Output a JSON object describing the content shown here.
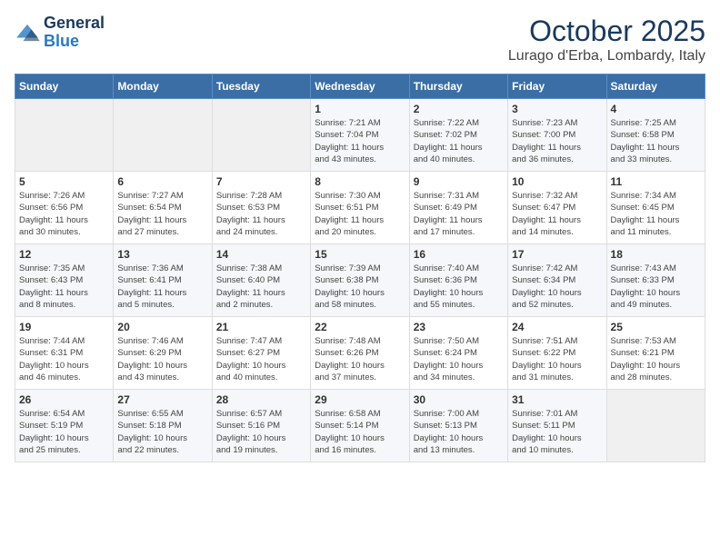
{
  "logo": {
    "line1": "General",
    "line2": "Blue"
  },
  "title": "October 2025",
  "location": "Lurago d'Erba, Lombardy, Italy",
  "days_header": [
    "Sunday",
    "Monday",
    "Tuesday",
    "Wednesday",
    "Thursday",
    "Friday",
    "Saturday"
  ],
  "weeks": [
    [
      {
        "day": "",
        "info": ""
      },
      {
        "day": "",
        "info": ""
      },
      {
        "day": "",
        "info": ""
      },
      {
        "day": "1",
        "info": "Sunrise: 7:21 AM\nSunset: 7:04 PM\nDaylight: 11 hours\nand 43 minutes."
      },
      {
        "day": "2",
        "info": "Sunrise: 7:22 AM\nSunset: 7:02 PM\nDaylight: 11 hours\nand 40 minutes."
      },
      {
        "day": "3",
        "info": "Sunrise: 7:23 AM\nSunset: 7:00 PM\nDaylight: 11 hours\nand 36 minutes."
      },
      {
        "day": "4",
        "info": "Sunrise: 7:25 AM\nSunset: 6:58 PM\nDaylight: 11 hours\nand 33 minutes."
      }
    ],
    [
      {
        "day": "5",
        "info": "Sunrise: 7:26 AM\nSunset: 6:56 PM\nDaylight: 11 hours\nand 30 minutes."
      },
      {
        "day": "6",
        "info": "Sunrise: 7:27 AM\nSunset: 6:54 PM\nDaylight: 11 hours\nand 27 minutes."
      },
      {
        "day": "7",
        "info": "Sunrise: 7:28 AM\nSunset: 6:53 PM\nDaylight: 11 hours\nand 24 minutes."
      },
      {
        "day": "8",
        "info": "Sunrise: 7:30 AM\nSunset: 6:51 PM\nDaylight: 11 hours\nand 20 minutes."
      },
      {
        "day": "9",
        "info": "Sunrise: 7:31 AM\nSunset: 6:49 PM\nDaylight: 11 hours\nand 17 minutes."
      },
      {
        "day": "10",
        "info": "Sunrise: 7:32 AM\nSunset: 6:47 PM\nDaylight: 11 hours\nand 14 minutes."
      },
      {
        "day": "11",
        "info": "Sunrise: 7:34 AM\nSunset: 6:45 PM\nDaylight: 11 hours\nand 11 minutes."
      }
    ],
    [
      {
        "day": "12",
        "info": "Sunrise: 7:35 AM\nSunset: 6:43 PM\nDaylight: 11 hours\nand 8 minutes."
      },
      {
        "day": "13",
        "info": "Sunrise: 7:36 AM\nSunset: 6:41 PM\nDaylight: 11 hours\nand 5 minutes."
      },
      {
        "day": "14",
        "info": "Sunrise: 7:38 AM\nSunset: 6:40 PM\nDaylight: 11 hours\nand 2 minutes."
      },
      {
        "day": "15",
        "info": "Sunrise: 7:39 AM\nSunset: 6:38 PM\nDaylight: 10 hours\nand 58 minutes."
      },
      {
        "day": "16",
        "info": "Sunrise: 7:40 AM\nSunset: 6:36 PM\nDaylight: 10 hours\nand 55 minutes."
      },
      {
        "day": "17",
        "info": "Sunrise: 7:42 AM\nSunset: 6:34 PM\nDaylight: 10 hours\nand 52 minutes."
      },
      {
        "day": "18",
        "info": "Sunrise: 7:43 AM\nSunset: 6:33 PM\nDaylight: 10 hours\nand 49 minutes."
      }
    ],
    [
      {
        "day": "19",
        "info": "Sunrise: 7:44 AM\nSunset: 6:31 PM\nDaylight: 10 hours\nand 46 minutes."
      },
      {
        "day": "20",
        "info": "Sunrise: 7:46 AM\nSunset: 6:29 PM\nDaylight: 10 hours\nand 43 minutes."
      },
      {
        "day": "21",
        "info": "Sunrise: 7:47 AM\nSunset: 6:27 PM\nDaylight: 10 hours\nand 40 minutes."
      },
      {
        "day": "22",
        "info": "Sunrise: 7:48 AM\nSunset: 6:26 PM\nDaylight: 10 hours\nand 37 minutes."
      },
      {
        "day": "23",
        "info": "Sunrise: 7:50 AM\nSunset: 6:24 PM\nDaylight: 10 hours\nand 34 minutes."
      },
      {
        "day": "24",
        "info": "Sunrise: 7:51 AM\nSunset: 6:22 PM\nDaylight: 10 hours\nand 31 minutes."
      },
      {
        "day": "25",
        "info": "Sunrise: 7:53 AM\nSunset: 6:21 PM\nDaylight: 10 hours\nand 28 minutes."
      }
    ],
    [
      {
        "day": "26",
        "info": "Sunrise: 6:54 AM\nSunset: 5:19 PM\nDaylight: 10 hours\nand 25 minutes."
      },
      {
        "day": "27",
        "info": "Sunrise: 6:55 AM\nSunset: 5:18 PM\nDaylight: 10 hours\nand 22 minutes."
      },
      {
        "day": "28",
        "info": "Sunrise: 6:57 AM\nSunset: 5:16 PM\nDaylight: 10 hours\nand 19 minutes."
      },
      {
        "day": "29",
        "info": "Sunrise: 6:58 AM\nSunset: 5:14 PM\nDaylight: 10 hours\nand 16 minutes."
      },
      {
        "day": "30",
        "info": "Sunrise: 7:00 AM\nSunset: 5:13 PM\nDaylight: 10 hours\nand 13 minutes."
      },
      {
        "day": "31",
        "info": "Sunrise: 7:01 AM\nSunset: 5:11 PM\nDaylight: 10 hours\nand 10 minutes."
      },
      {
        "day": "",
        "info": ""
      }
    ]
  ]
}
